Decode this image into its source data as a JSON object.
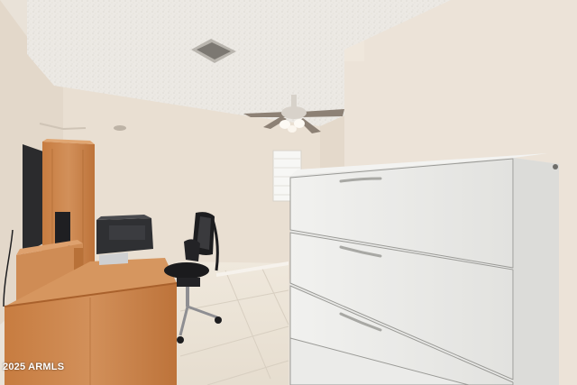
{
  "photo": {
    "watermark": "2025 ARMLS",
    "colors": {
      "ceiling": "#ece9e4",
      "wall_left": "#e7ddd0",
      "wall_back": "#e9dfd2",
      "wall_right": "#ece3d8",
      "floor": "#ece5d9",
      "cabinet": "#ececea",
      "desk_wood": "#c9834a",
      "printer": "#2f3033",
      "chair": "#1d1d1f"
    }
  }
}
